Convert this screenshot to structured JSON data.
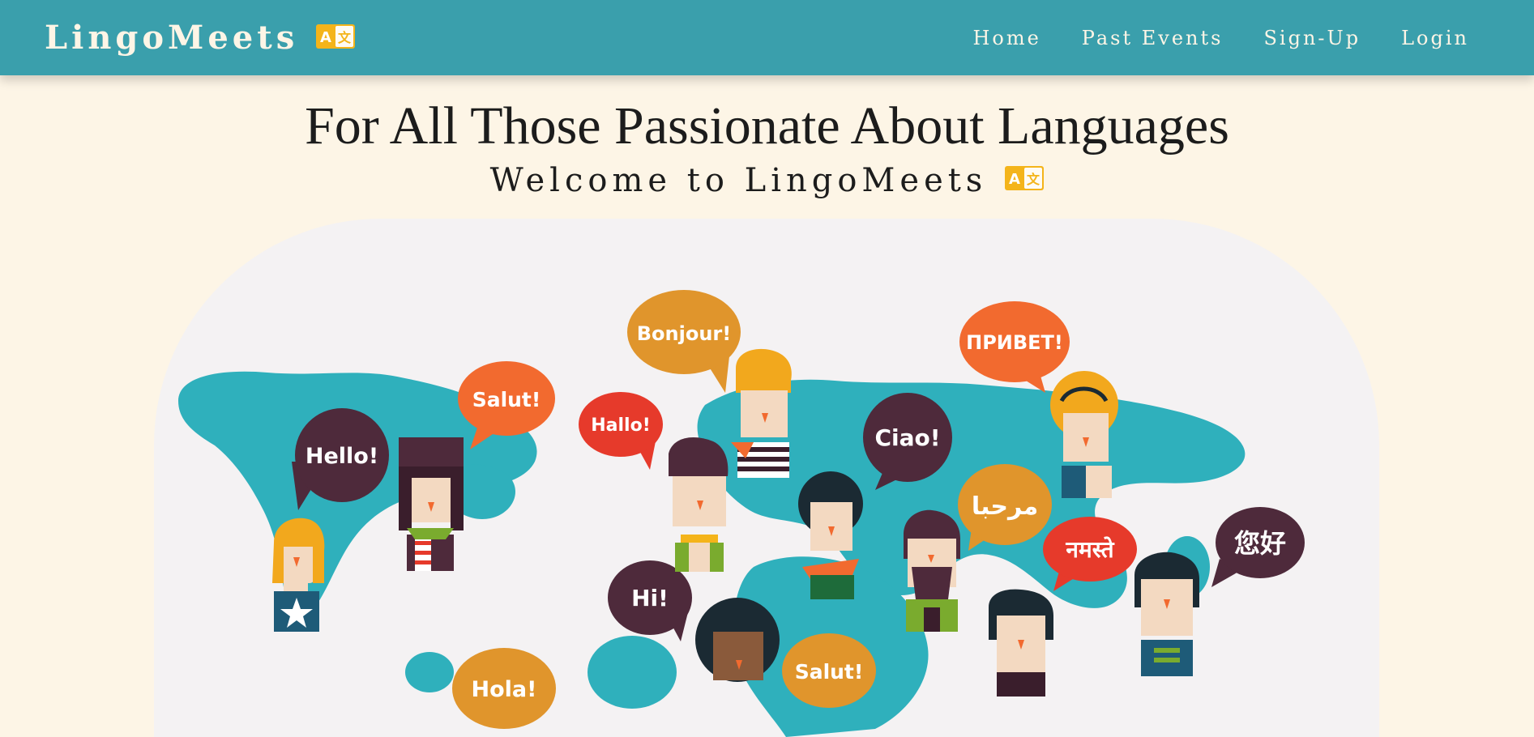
{
  "navbar": {
    "brand": "LingoMeets",
    "links": {
      "home": "Home",
      "past_events": "Past Events",
      "signup": "Sign-Up",
      "login": "Login"
    }
  },
  "hero": {
    "title": "For All Those Passionate About Languages",
    "subtitle": "Welcome to LingoMeets"
  },
  "illustration": {
    "greetings": {
      "hello": "Hello!",
      "salut_top": "Salut!",
      "hallo": "Hallo!",
      "bonjour": "Bonjour!",
      "privet": "ПРИВЕТ!",
      "ciao": "Ciao!",
      "marhaba": "مرحبا",
      "namaste": "नमस्ते",
      "nihao": "您好",
      "hi": "Hi!",
      "salut_bottom": "Salut!",
      "hola": "Hola!"
    },
    "colors": {
      "map": "#2fb0bc",
      "plum": "#4e2a3b",
      "orange": "#f26a2f",
      "red": "#e63a2b",
      "mustard": "#e0952c",
      "background": "#f4f2f3"
    }
  }
}
